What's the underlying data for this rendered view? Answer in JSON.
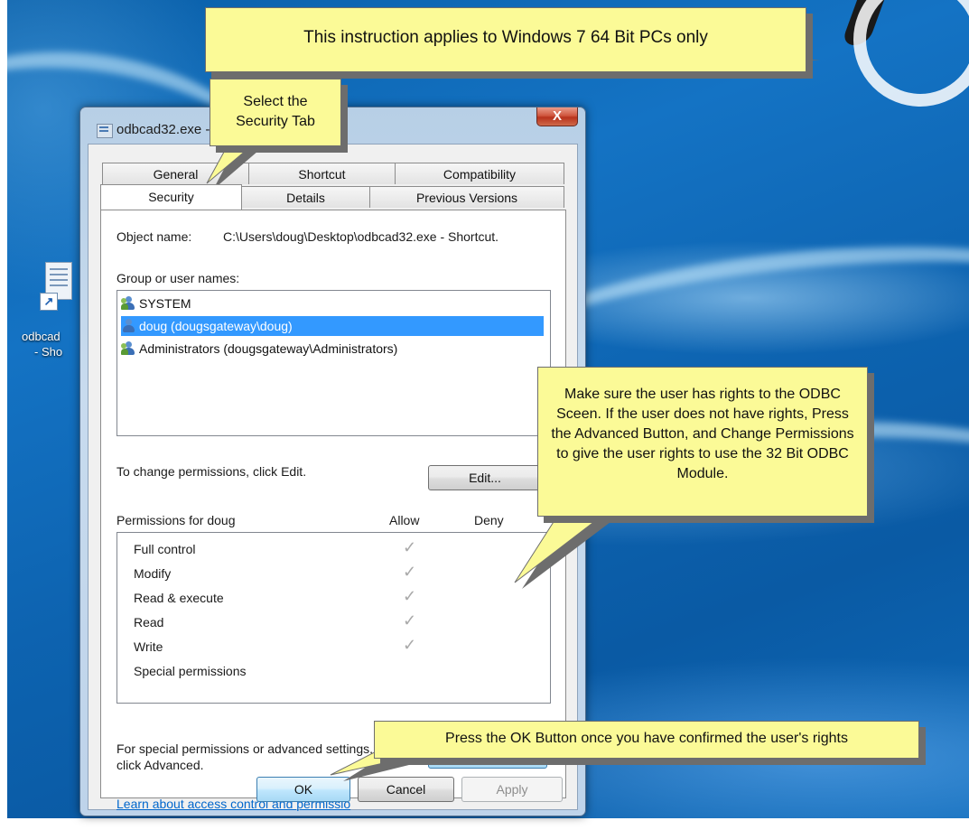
{
  "dialog": {
    "title": "odbcad32.exe - Shortcut Properties",
    "close_label": "X"
  },
  "tabs": {
    "row1": [
      "General",
      "Shortcut",
      "Compatibility"
    ],
    "row2": [
      "Security",
      "Details",
      "Previous Versions"
    ],
    "active": "Security"
  },
  "security": {
    "object_label": "Object name:",
    "object_value": "C:\\Users\\doug\\Desktop\\odbcad32.exe - Shortcut.",
    "group_label": "Group or user names:",
    "users": [
      {
        "name": "SYSTEM",
        "icon": "group-user-icon",
        "selected": false
      },
      {
        "name": "doug (dougsgateway\\doug)",
        "icon": "user-icon",
        "selected": true
      },
      {
        "name": "Administrators (dougsgateway\\Administrators)",
        "icon": "group-user-icon",
        "selected": false
      }
    ],
    "change_text": "To change permissions, click Edit.",
    "edit_label": "Edit...",
    "perm_header": "Permissions for doug",
    "allow_header": "Allow",
    "deny_header": "Deny",
    "permissions": [
      {
        "name": "Full control",
        "allow": true,
        "deny": false
      },
      {
        "name": "Modify",
        "allow": true,
        "deny": false
      },
      {
        "name": "Read & execute",
        "allow": true,
        "deny": false
      },
      {
        "name": "Read",
        "allow": true,
        "deny": false
      },
      {
        "name": "Write",
        "allow": true,
        "deny": false
      },
      {
        "name": "Special permissions",
        "allow": false,
        "deny": false
      }
    ],
    "special_text_1": "For special permissions or advanced settings,",
    "special_text_2": "click Advanced.",
    "advanced_label": "Advanced",
    "learn_link": "Learn about access control and permissio"
  },
  "footer": {
    "ok_label": "OK",
    "cancel_label": "Cancel",
    "apply_label": "Apply"
  },
  "desktop": {
    "shortcut_label_1": "odbcad",
    "shortcut_label_2": "- Sho"
  },
  "callouts": {
    "top": "This instruction applies to Windows 7 64 Bit PCs only",
    "tab_line1": "Select the",
    "tab_line2": "Security Tab",
    "rights": "Make sure the user has rights to the ODBC Sceen.  If the user does not have rights, Press the Advanced Button, and Change Permissions to give the user rights to use the 32 Bit ODBC Module.",
    "ok": "Press the OK Button once you have confirmed the user's rights"
  },
  "colors": {
    "callout_bg": "#fbfa97",
    "selection": "#3399ff",
    "desktop": "#0a5fa8"
  }
}
